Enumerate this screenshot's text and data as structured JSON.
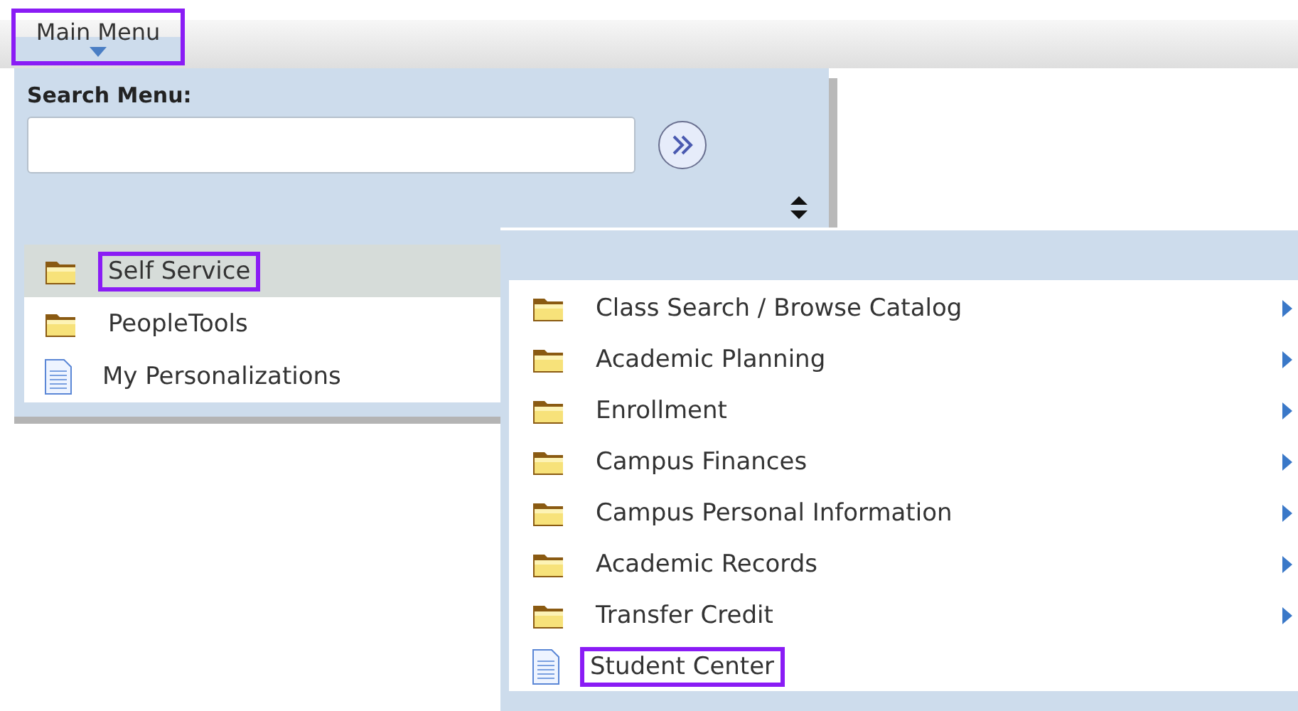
{
  "menu_button": {
    "label": "Main Menu",
    "highlighted": true
  },
  "search": {
    "label": "Search Menu:"
  },
  "menu_items": [
    {
      "label": "Self Service",
      "kind": "folder",
      "selected": true,
      "highlighted": true
    },
    {
      "label": "PeopleTools",
      "kind": "folder",
      "selected": false,
      "highlighted": false
    },
    {
      "label": "My Personalizations",
      "kind": "page",
      "selected": false,
      "highlighted": false
    }
  ],
  "submenu_items": [
    {
      "label": "Class Search / Browse Catalog",
      "kind": "folder",
      "has_submenu": true,
      "highlighted": false
    },
    {
      "label": "Academic Planning",
      "kind": "folder",
      "has_submenu": true,
      "highlighted": false
    },
    {
      "label": "Enrollment",
      "kind": "folder",
      "has_submenu": true,
      "highlighted": false
    },
    {
      "label": "Campus Finances",
      "kind": "folder",
      "has_submenu": true,
      "highlighted": false
    },
    {
      "label": "Campus Personal Information",
      "kind": "folder",
      "has_submenu": true,
      "highlighted": false
    },
    {
      "label": "Academic Records",
      "kind": "folder",
      "has_submenu": true,
      "highlighted": false
    },
    {
      "label": "Transfer Credit",
      "kind": "folder",
      "has_submenu": true,
      "highlighted": false
    },
    {
      "label": "Student Center",
      "kind": "page",
      "has_submenu": false,
      "highlighted": true
    }
  ]
}
